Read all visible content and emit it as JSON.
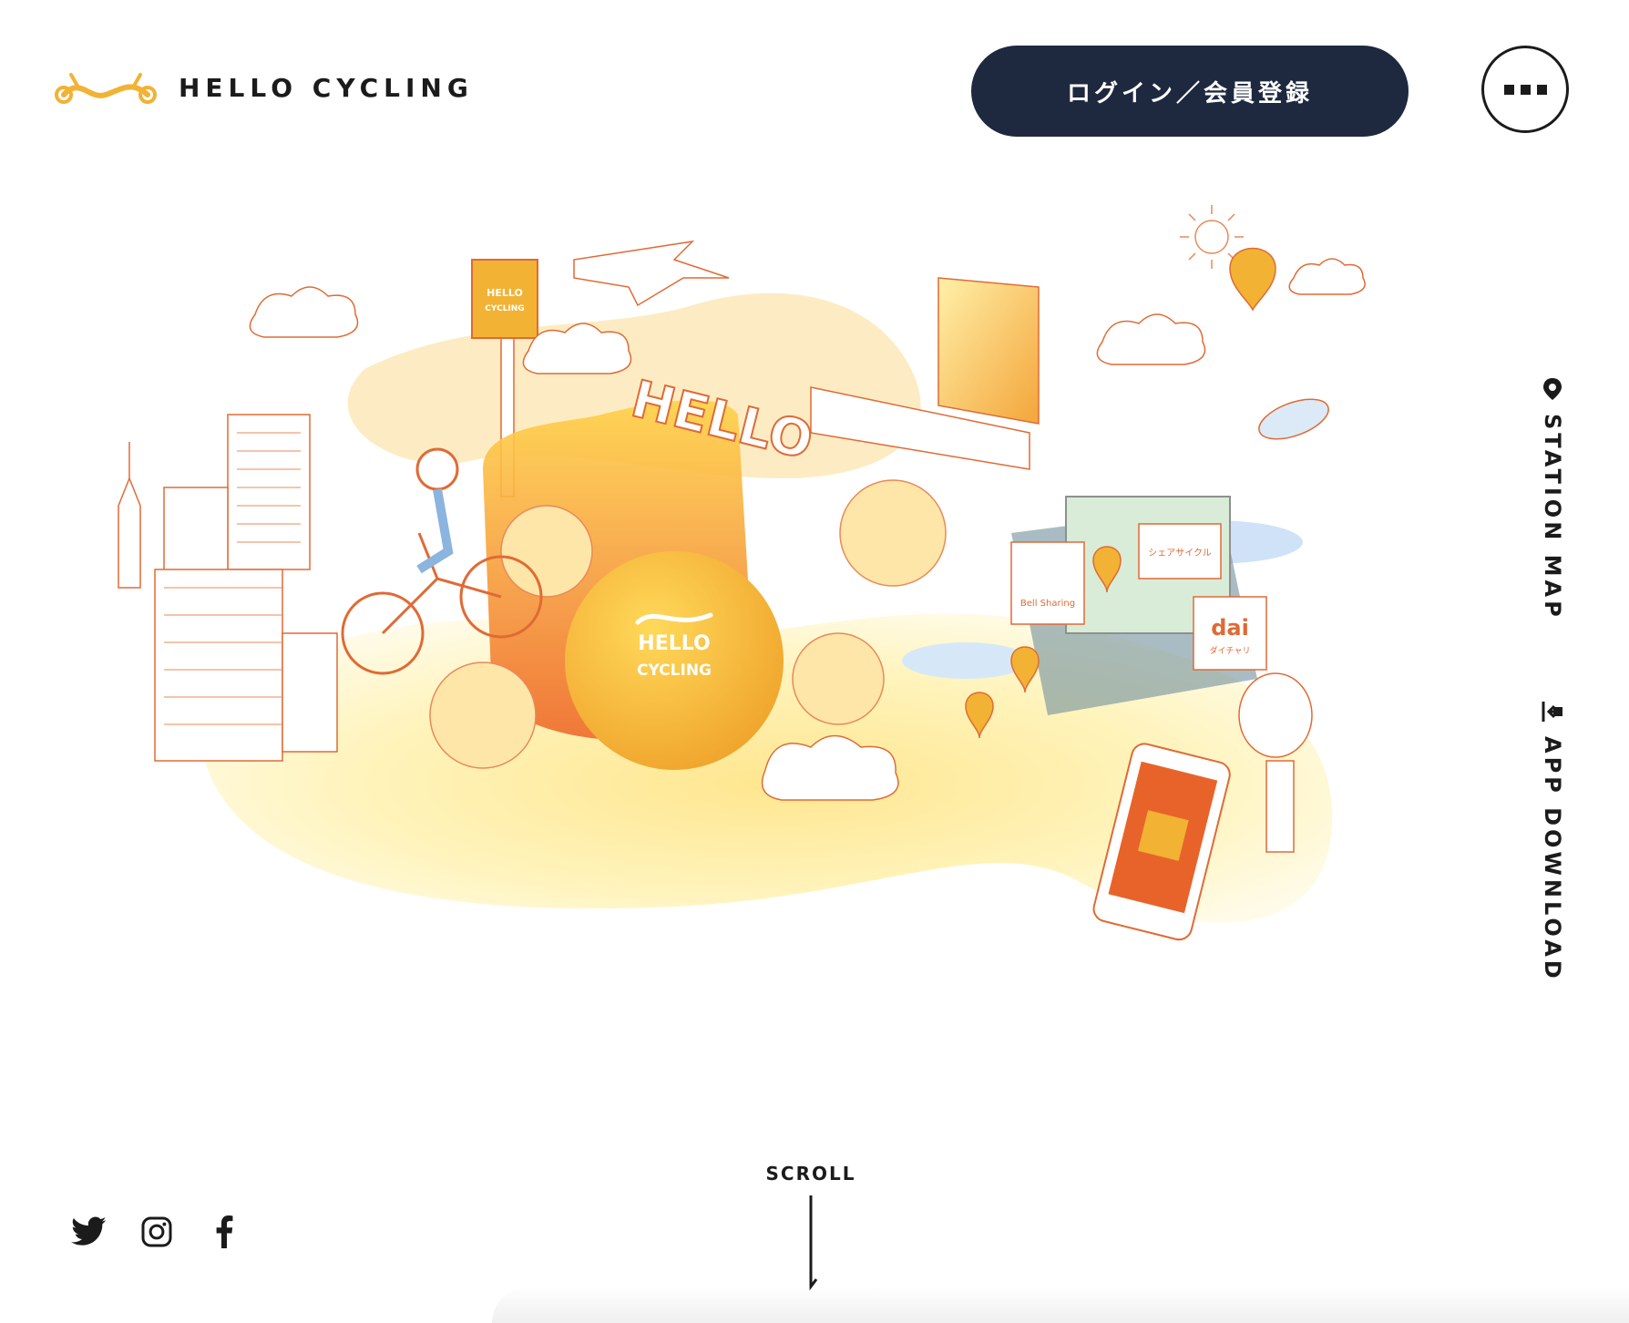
{
  "header": {
    "logo_text": "HELLO CYCLING",
    "login_label": "ログイン／会員登録",
    "menu_icon": "more-dots-icon"
  },
  "hero": {
    "sign_text_1": "HELLO",
    "sign_text_2": "CYCLING",
    "big_word": "HELLO",
    "sphere_text_1": "HELLO",
    "sphere_text_2": "CYCLING",
    "partner_1": "Bell Sharing",
    "partner_2": "シェアサイクル",
    "partner_3": "dai",
    "partner_3_sub": "ダイチャリ"
  },
  "side_nav": {
    "station_map": "STATION MAP",
    "app_download": "APP DOWNLOAD",
    "station_icon": "map-pin-icon",
    "download_icon": "download-icon"
  },
  "footer": {
    "scroll_label": "SCROLL",
    "social": [
      "twitter-icon",
      "instagram-icon",
      "facebook-icon"
    ]
  },
  "colors": {
    "brand_yellow": "#f2b233",
    "brand_orange": "#e8632a",
    "navy": "#1e293f"
  }
}
